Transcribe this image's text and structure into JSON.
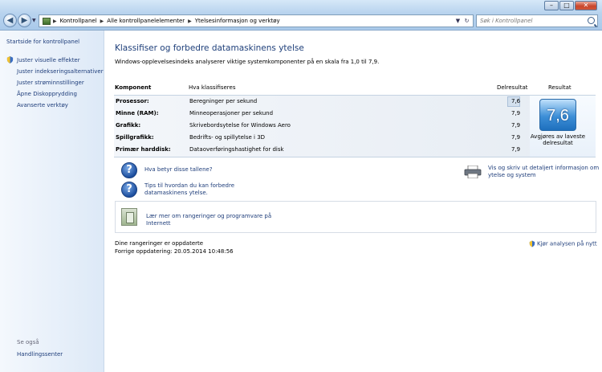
{
  "window": {
    "minimize": "–",
    "maximize": "□",
    "close": "✕"
  },
  "address": {
    "crumbs": [
      "Kontrollpanel",
      "Alle kontrollpanelelementer",
      "Ytelsesinformasjon og verktøy"
    ],
    "refresh_icon": "refresh-icon"
  },
  "search": {
    "placeholder": "Søk i Kontrollpanel"
  },
  "sidebar": {
    "home": "Startside for kontrollpanel",
    "items": [
      "Juster visuelle effekter",
      "Juster indekseringsalternativer",
      "Juster strøminnstillinger",
      "Åpne Diskopprydding",
      "Avanserte verktøy"
    ],
    "see_also_label": "Se også",
    "see_also_items": [
      "Handlingssenter"
    ]
  },
  "main": {
    "title": "Klassifiser og forbedre datamaskinens ytelse",
    "intro": "Windows-opplevelsesindeks analyserer viktige systemkomponenter på en skala fra 1,0 til 7,9.",
    "table": {
      "headers": {
        "component": "Komponent",
        "what": "Hva klassifiseres",
        "subscore": "Delresultat",
        "result": "Resultat"
      },
      "rows": [
        {
          "component": "Prosessor:",
          "what": "Beregninger per sekund",
          "score": "7,6"
        },
        {
          "component": "Minne (RAM):",
          "what": "Minneoperasjoner per sekund",
          "score": "7,9"
        },
        {
          "component": "Grafikk:",
          "what": "Skrivebordsytelse for Windows Aero",
          "score": "7,9"
        },
        {
          "component": "Spillgrafikk:",
          "what": "Bedrifts- og spillytelse i 3D",
          "score": "7,9"
        },
        {
          "component": "Primær harddisk:",
          "what": "Dataoverføringshastighet for disk",
          "score": "7,9"
        }
      ],
      "base_score": "7,6",
      "base_caption": "Avgjøres av laveste delresultat"
    },
    "help_links": {
      "what_numbers": "Hva betyr disse tallene?",
      "tips": "Tips til hvordan du kan forbedre datamaskinens ytelse.",
      "details": "Vis og skriv ut detaljert informasjon om ytelse og system"
    },
    "online_box": "Lær mer om rangeringer og programvare på Internett",
    "status": {
      "line1": "Dine rangeringer er oppdaterte",
      "line2": "Forrige oppdatering: 20.05.2014 10:48:56"
    },
    "rerun": "Kjør analysen på nytt"
  }
}
